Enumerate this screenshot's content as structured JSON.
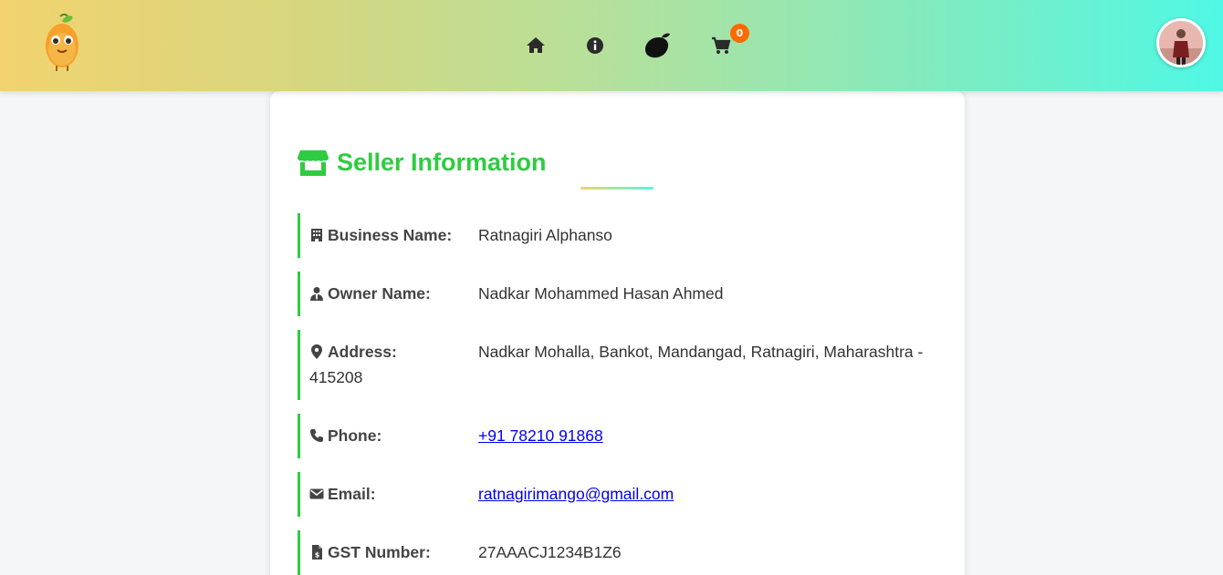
{
  "header": {
    "icons": [
      "mango-mascot-logo",
      "home-icon",
      "info-icon",
      "mango-icon",
      "cart-icon",
      "user-avatar"
    ],
    "cart_count": "0"
  },
  "seller": {
    "title": "Seller Information",
    "business_label": "Business Name:",
    "business_value": "Ratnagiri Alphanso",
    "owner_label": "Owner Name:",
    "owner_value": "Nadkar Mohammed Hasan Ahmed",
    "address_label": "Address:",
    "address_value": "Nadkar Mohalla, Bankot, Mandangad, Ratnagiri, Maharashtra - 415208",
    "phone_label": "Phone:",
    "phone_value": "+91 78210 91868",
    "email_label": "Email:",
    "email_value": "ratnagirimango@gmail.com",
    "gst_label": "GST Number:",
    "gst_value": "27AAACJ1234B1Z6"
  },
  "colors": {
    "accent_green": "#2ecc40",
    "badge_orange": "#ff6a00",
    "header_gradient_start": "#f2d36f",
    "header_gradient_end": "#4ff8e4",
    "link_blue": "#0000ee"
  }
}
